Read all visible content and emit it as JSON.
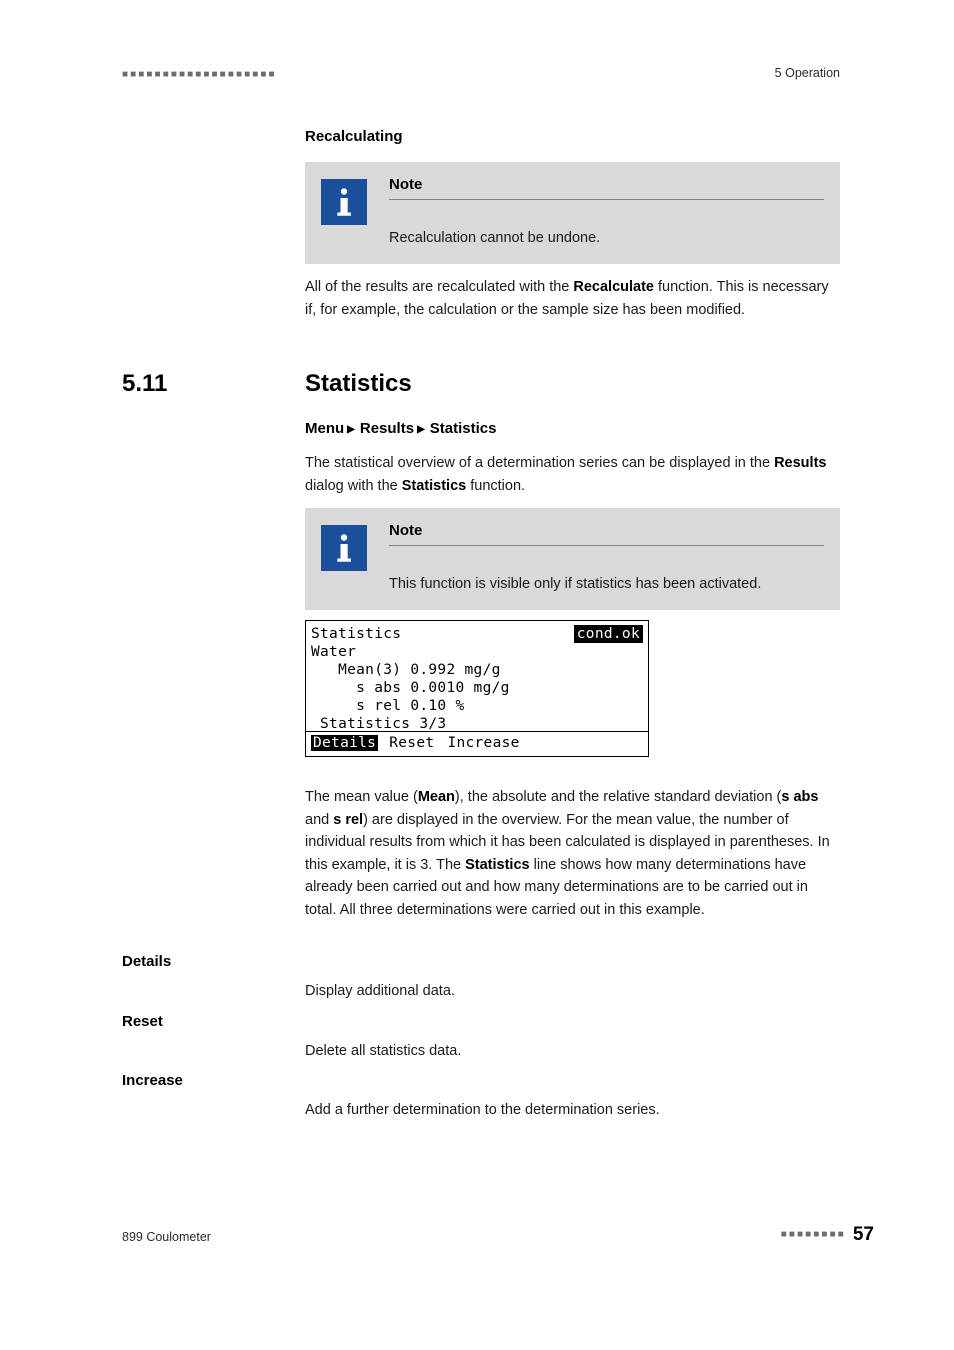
{
  "header": {
    "dots": "■■■■■■■■■■■■■■■■■■■",
    "right": "5 Operation"
  },
  "footer": {
    "left": "899 Coulometer",
    "dots": "■■■■■■■■",
    "page_number": "57"
  },
  "recalculating": {
    "heading": "Recalculating",
    "note": {
      "title": "Note",
      "text": "Recalculation cannot be undone."
    },
    "paragraph_1": "All of the results are recalculated with the ",
    "paragraph_1_bold": "Recalculate",
    "paragraph_1_cont": " function. This is necessary if, for example, the calculation or the sample size has been modified."
  },
  "statistics": {
    "number": "5.11",
    "title": "Statistics",
    "breadcrumb": {
      "menu": "Menu",
      "results": "Results",
      "statistics": "Statistics"
    },
    "intro_a": "The statistical overview of a determination series can be displayed in the ",
    "intro_b": "Results",
    "intro_c": " dialog with the ",
    "intro_d": "Statistics",
    "intro_e": " function.",
    "note": {
      "title": "Note",
      "text": "This function is visible only if statistics has been activated."
    },
    "lcd": {
      "title": "Statistics",
      "status": "cond.ok",
      "line_2": "Water",
      "line_3": "   Mean(3) 0.992 mg/g",
      "line_4": "     s abs 0.0010 mg/g",
      "line_5": "     s rel 0.10 %",
      "line_6": " Statistics 3/3",
      "button_details": "Details",
      "button_reset": "Reset",
      "button_increase": "Increase"
    },
    "description": {
      "p1": "The mean value (",
      "b1": "Mean",
      "p2": "), the absolute and the relative standard deviation (",
      "b2": "s abs",
      "p3": " and ",
      "b3": "s rel",
      "p4": ") are displayed in the overview. For the mean value, the number of individual results from which it has been calculated is displayed in parentheses. In this example, it is 3. The ",
      "b4": "Statistics",
      "p5": " line shows how many determinations have already been carried out and how many determinations are to be carried out in total. All three determinations were carried out in this example."
    },
    "entries": [
      {
        "label": "Details",
        "text": "Display additional data."
      },
      {
        "label": "Reset",
        "text": "Delete all statistics data."
      },
      {
        "label": "Increase",
        "text": "Add a further determination to the determination series."
      }
    ]
  }
}
